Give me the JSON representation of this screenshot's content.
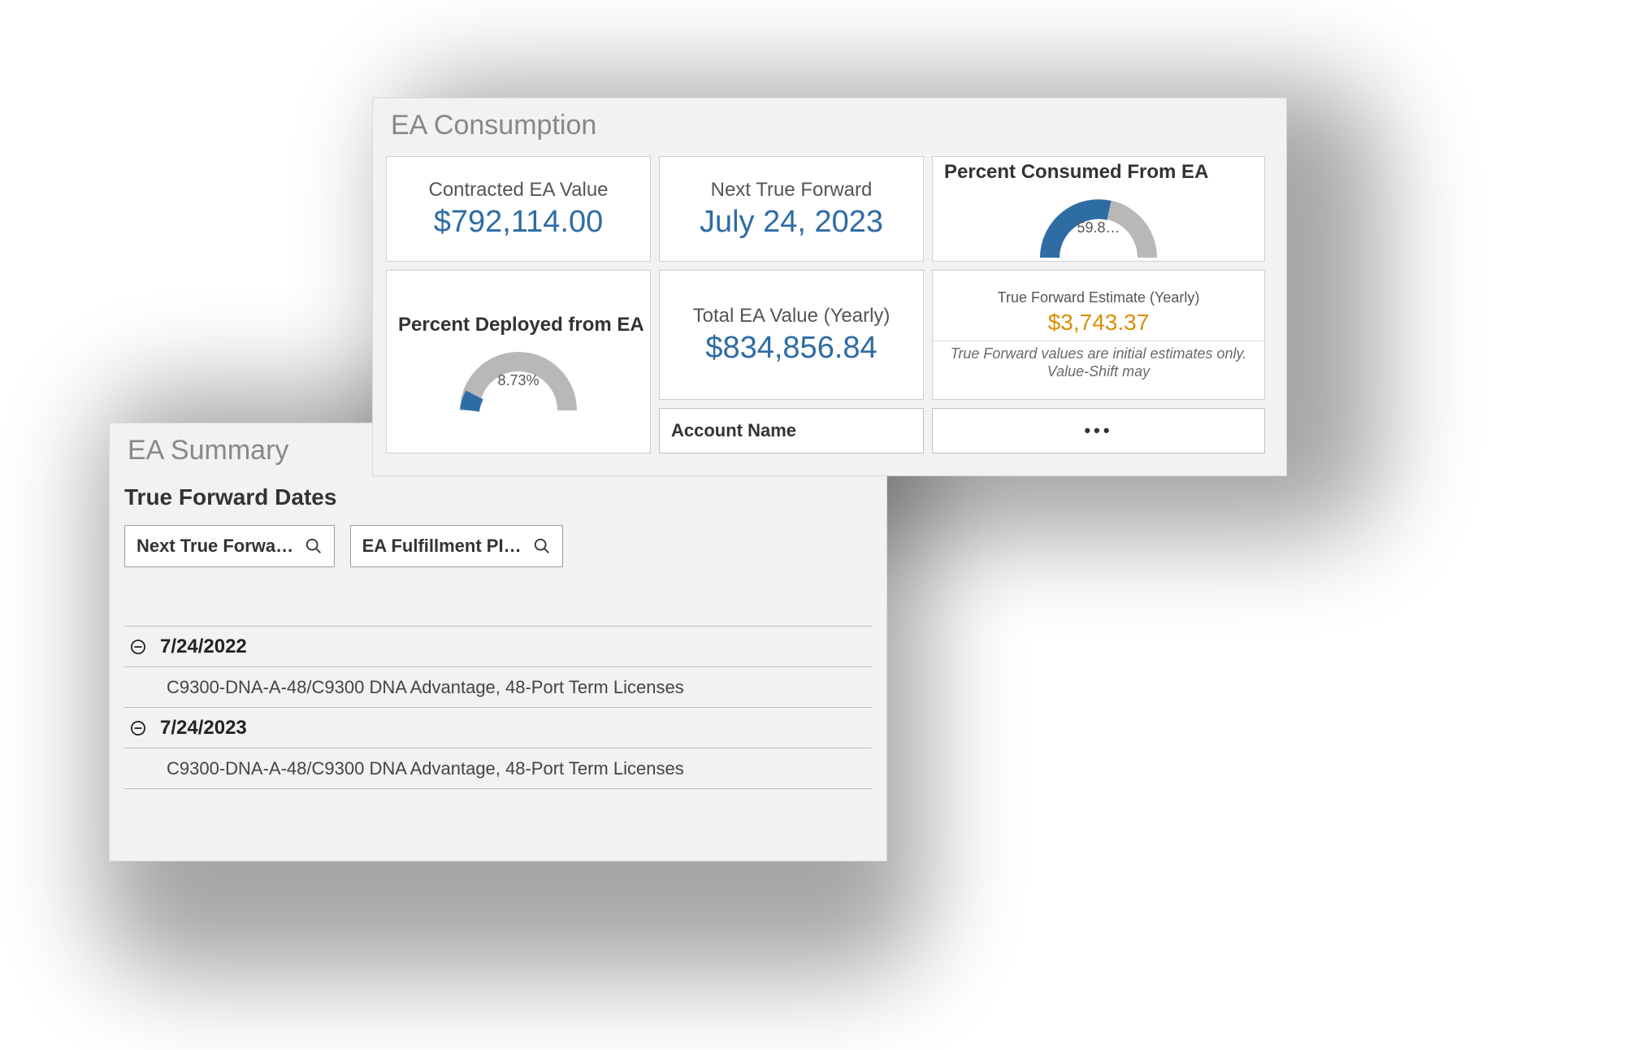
{
  "consumption": {
    "title": "EA Consumption",
    "contracted_label": "Contracted EA Value",
    "contracted_value": "$792,114.00",
    "next_tf_label": "Next True Forward",
    "next_tf_value": "July 24, 2023",
    "total_label": "Total EA Value (Yearly)",
    "total_value": "$834,856.84",
    "tf_est_label": "True Forward Estimate (Yearly)",
    "tf_est_value": "$3,743.37",
    "tf_est_note": "True Forward values are initial estimates only. Value-Shift may",
    "account_name_label": "Account Name",
    "account_select_label": "•••",
    "pct_consumed_label": "Percent Consumed From EA",
    "pct_deployed_label": "Percent Deployed from EA"
  },
  "summary": {
    "title": "EA Summary",
    "subtitle": "True Forward Dates",
    "filter_next_tf": "Next True Forwa…",
    "filter_fulfillment": "EA Fulfillment PI…",
    "groups": [
      {
        "date": "7/24/2022",
        "item": "C9300-DNA-A-48/C9300 DNA Advantage, 48-Port Term Licenses"
      },
      {
        "date": "7/24/2023",
        "item": "C9300-DNA-A-48/C9300 DNA Advantage, 48-Port Term Licenses"
      }
    ]
  },
  "chart_data": [
    {
      "type": "gauge",
      "title": "Percent Consumed From EA",
      "value": 59.8,
      "value_label": "59.8…",
      "min": 0,
      "max": 100,
      "unit": "%"
    },
    {
      "type": "gauge",
      "title": "Percent Deployed from EA",
      "value": 8.73,
      "value_label": "8.73%",
      "min": 0,
      "max": 100,
      "unit": "%"
    }
  ]
}
